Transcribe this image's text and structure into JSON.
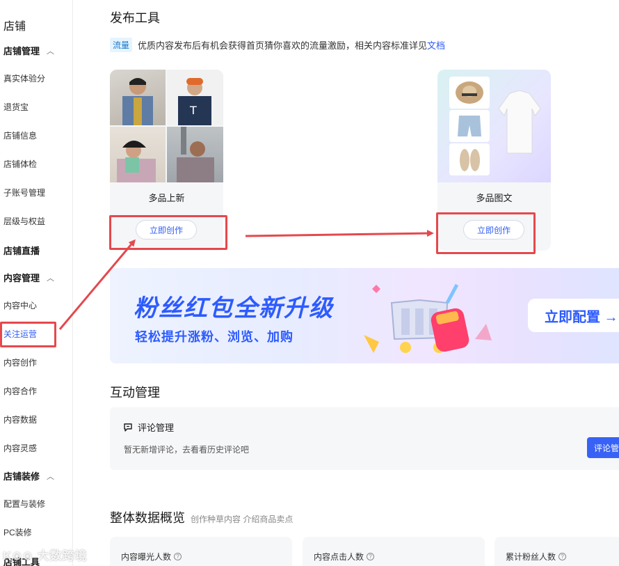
{
  "sidebar": {
    "top": "店铺",
    "sections": [
      {
        "label": "店铺管理"
      },
      {
        "label": "店铺直播"
      },
      {
        "label": "内容管理"
      },
      {
        "label": "店铺装修"
      },
      {
        "label": "店铺工具"
      }
    ],
    "items": [
      {
        "label": "真实体验分"
      },
      {
        "label": "退货宝"
      },
      {
        "label": "店铺信息"
      },
      {
        "label": "店铺体检"
      },
      {
        "label": "子账号管理"
      },
      {
        "label": "层级与权益"
      },
      {
        "label": "内容中心"
      },
      {
        "label": "关注运营"
      },
      {
        "label": "内容创作"
      },
      {
        "label": "内容合作"
      },
      {
        "label": "内容数据"
      },
      {
        "label": "内容灵感"
      },
      {
        "label": "配置与装修"
      },
      {
        "label": "PC装修"
      }
    ]
  },
  "publish": {
    "title": "发布工具",
    "tag": "流量",
    "notice": "优质内容发布后有机会获得首页猜你喜欢的流量激励，相关内容标准详见",
    "notice_link": "文档",
    "cards": [
      {
        "caption": "多品上新",
        "button": "立即创作"
      },
      {
        "caption": "多品图文",
        "button": "立即创作"
      }
    ]
  },
  "banner": {
    "title": "粉丝红包全新升级",
    "subtitle": "轻松提升涨粉、浏览、加购",
    "cta": "立即配置 →"
  },
  "interaction": {
    "title": "互动管理",
    "panel_title": "评论管理",
    "panel_sub": "暂无新增评论，去看看历史评论吧",
    "panel_button": "评论管"
  },
  "overview": {
    "title": "整体数据概览",
    "subtitle": "创作种草内容 介绍商品卖点",
    "stats": [
      {
        "label": "内容曝光人数"
      },
      {
        "label": "内容点击人数"
      },
      {
        "label": "累计粉丝人数"
      }
    ]
  },
  "watermark": "K⊙⊙ 大数跨境",
  "colors": {
    "accent": "#2f5cf5",
    "highlight": "#e5484d",
    "panel": "#f6f7f9"
  }
}
